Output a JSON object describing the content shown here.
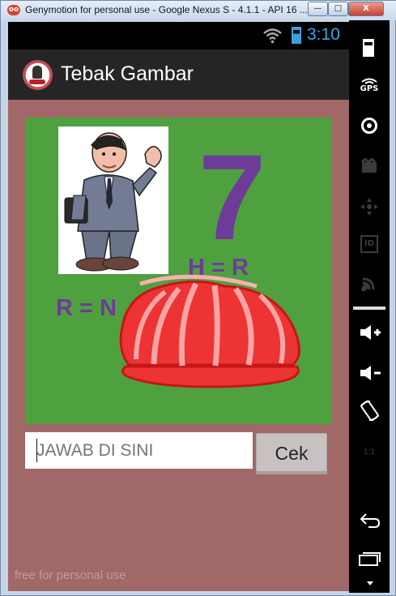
{
  "window": {
    "title": "Genymotion for personal use - Google Nexus S - 4.1.1 - API 16 ...",
    "minimize": "—",
    "maximize": "□",
    "close": "X"
  },
  "statusbar": {
    "time": "3:10"
  },
  "actionbar": {
    "title": "Tebak Gambar"
  },
  "puzzle": {
    "number": "7",
    "hint_left": "R = N",
    "hint_right": "H = R"
  },
  "answer": {
    "placeholder": "JAWAB DI SINI",
    "button_label": "Cek"
  },
  "watermark": "free for personal use",
  "side_controls": {
    "gps_label": "GPS",
    "id_label": "ID",
    "scale_label": "1:1"
  },
  "colors": {
    "app_background": "#a16868",
    "puzzle_background": "#4fa13f",
    "number_color": "#6d3c99",
    "status_blue": "#35a7e8"
  },
  "icons": [
    "battery-icon",
    "gps-icon",
    "camera-icon",
    "video-icon",
    "dpad-icon",
    "id-icon",
    "cast-icon",
    "volume-up-icon",
    "volume-down-icon",
    "rotate-icon",
    "scale-icon",
    "back-icon",
    "recent-apps-icon"
  ]
}
